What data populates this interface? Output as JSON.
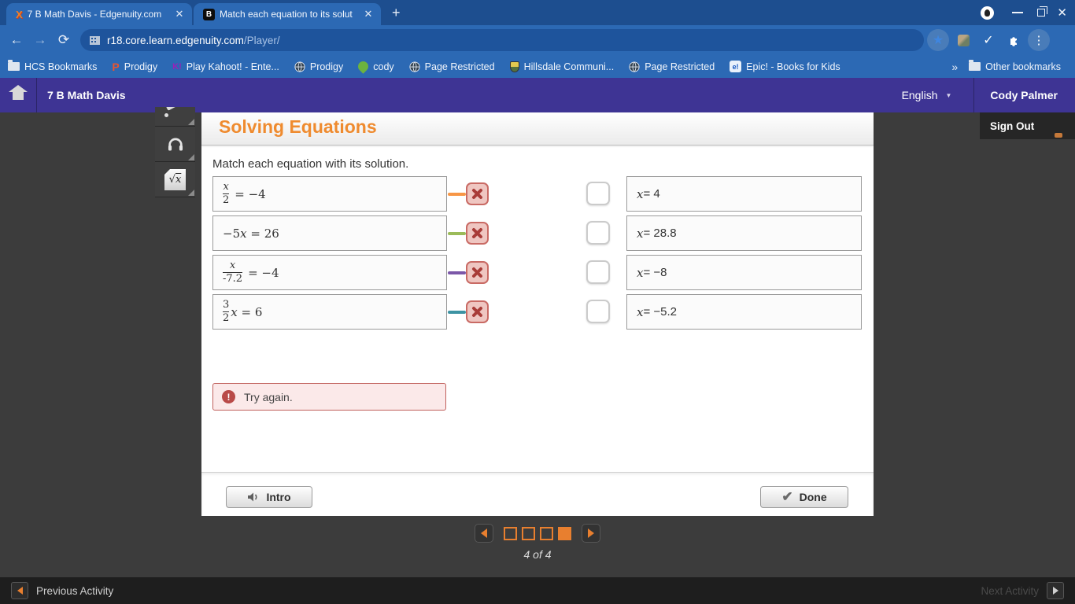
{
  "browser": {
    "tabs": [
      {
        "title": "7 B Math Davis - Edgenuity.com",
        "favicon": "edgenuity"
      },
      {
        "title": "Match each equation to its solut",
        "favicon": "brainly"
      }
    ],
    "url_host": "r18.core.learn.edgenuity.com",
    "url_path": "/Player/",
    "bookmarks": [
      "HCS Bookmarks",
      "Prodigy",
      "Play Kahoot! - Ente...",
      "Prodigy",
      "cody",
      "Page Restricted",
      "Hillsdale Communi...",
      "Page Restricted",
      "Epic! - Books for Kids"
    ],
    "other_bookmarks": "Other bookmarks",
    "brainly_letter": "B",
    "epic_letter": "e!",
    "prodigy_letter": "P",
    "kahoot_letters": "K!"
  },
  "header": {
    "course_title": "7 B Math Davis",
    "language": "English",
    "user_name": "Cody Palmer",
    "sign_out": "Sign Out"
  },
  "lesson": {
    "title": "Solving Equations",
    "instruction": "Match each equation with its solution.",
    "equations": [
      {
        "num": "x",
        "den": "2",
        "rest": "= −4",
        "line_color": "#f79646"
      },
      {
        "pre": "−5",
        "var": "x",
        "post": " = 26",
        "line_color": "#9bbb59"
      },
      {
        "num": "x",
        "den": "-7.2",
        "rest": "= −4",
        "line_color": "#7b57a8"
      },
      {
        "num": "3",
        "den": "2",
        "var": "x",
        "rest": " = 6",
        "line_color": "#3d93a3"
      }
    ],
    "answers": [
      {
        "v": "x",
        "t": "= 4"
      },
      {
        "v": "x",
        "t": "= 28.8"
      },
      {
        "v": "x",
        "t": "= −8"
      },
      {
        "v": "x",
        "t": "= −5.2"
      }
    ],
    "feedback": "Try again.",
    "intro_label": "Intro",
    "done_label": "Done",
    "accent_color": "#ef8b2f",
    "error_color": "#b94a48"
  },
  "pagination": {
    "current_page": 4,
    "total_pages": 4,
    "label": "4 of 4"
  },
  "footer": {
    "previous": "Previous Activity",
    "next": "Next Activity"
  }
}
